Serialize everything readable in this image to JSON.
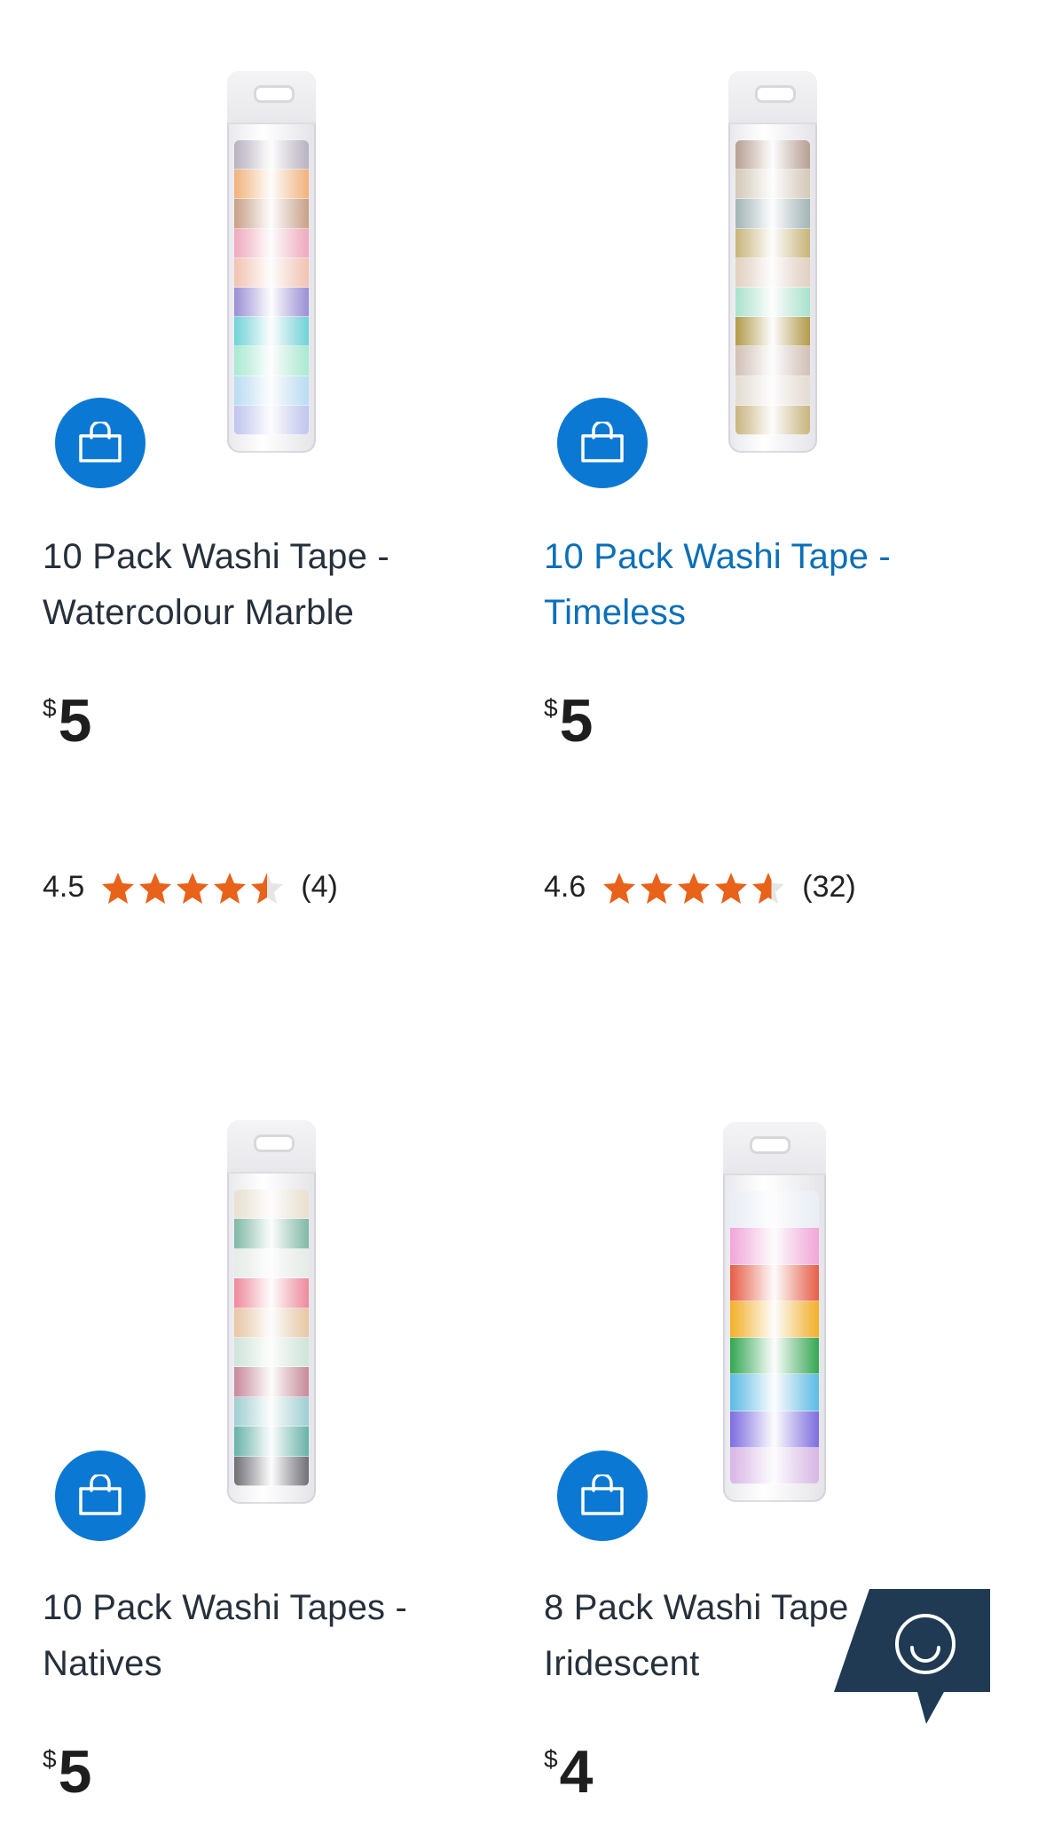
{
  "products": [
    {
      "title": "10 Pack Washi Tape - Watercolour Marble",
      "title_line1": "10 Pack Washi Tape -",
      "title_line2": "Watercolour Marble",
      "currency": "$",
      "price": "5",
      "rating": "4.5",
      "rating_value": 4.5,
      "review_count": "(4)",
      "title_color": "#26303b",
      "tape_colors": [
        "#b8b2c0",
        "#f3b27a",
        "#c9a088",
        "#f0a9bd",
        "#f3c3b1",
        "#9b8fd6",
        "#6fd3d7",
        "#a8ead2",
        "#b9dcf3",
        "#bfc5ee"
      ]
    },
    {
      "title": "10 Pack Washi Tape - Timeless",
      "title_line1": "10 Pack Washi Tape -",
      "title_line2": "Timeless",
      "currency": "$",
      "price": "5",
      "rating": "4.6",
      "rating_value": 4.6,
      "review_count": "(32)",
      "title_color": "#0b6fb8",
      "tape_colors": [
        "#b79f92",
        "#d4c9b8",
        "#a3b5b6",
        "#c9b479",
        "#e2cfc0",
        "#a9e3cc",
        "#b39b4a",
        "#d2c0b6",
        "#e4dcd2",
        "#cab57f"
      ]
    },
    {
      "title": "10 Pack Washi Tapes - Natives",
      "title_line1": "10 Pack Washi Tapes -",
      "title_line2": "Natives",
      "currency": "$",
      "price": "5",
      "title_color": "#26303b",
      "tape_colors": [
        "#e9e0cf",
        "#7fb9a6",
        "#e6ece7",
        "#ef8a9b",
        "#e8c7a4",
        "#cfe5d8",
        "#c78a9a",
        "#9fcfd2",
        "#67b3a8",
        "#6f6f76"
      ]
    },
    {
      "title": "8 Pack Washi Tapes - Iridescent",
      "title_line1": "8 Pack Washi Tape",
      "title_line2": "Iridescent",
      "currency": "$",
      "price": "4",
      "title_color": "#26303b",
      "tape_colors": [
        "#e9eef6",
        "#f2a6d8",
        "#e85d45",
        "#f3b027",
        "#33a852",
        "#5bbbe6",
        "#7e6de0",
        "#d9b6e6"
      ]
    }
  ],
  "colors": {
    "accent": "#0b78d3",
    "star": "#e8621a",
    "chat_bg": "#1f3a52"
  },
  "icons": {
    "cart": "shopping-bag-icon",
    "star": "star-icon",
    "chat": "chat-smiley-icon"
  }
}
